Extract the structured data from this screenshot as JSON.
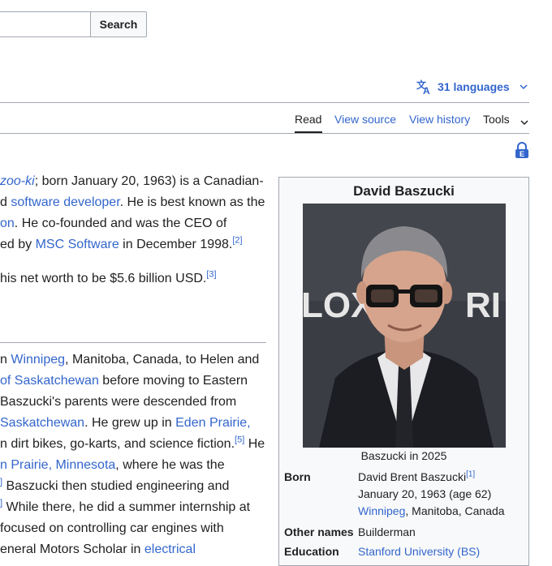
{
  "search": {
    "button_label": "Search",
    "placeholder": ""
  },
  "languages": {
    "label": "31 languages"
  },
  "tabs": {
    "read": "Read",
    "view_source": "View source",
    "view_history": "View history",
    "tools": "Tools"
  },
  "intro": {
    "line1_a": "zoo-ki",
    "line1_b": "; born January 20, 1963) is a Canadian-",
    "line2_a": "d ",
    "line2_link": "software developer",
    "line2_b": ". He is best known as the",
    "line3_link": "on",
    "line3_b": ". He co-founded and was the CEO of",
    "line4_a": "ed by ",
    "line4_link": "MSC Software",
    "line4_b": " in December 1998.",
    "line4_ref": "[2]",
    "line5_a": "his net worth to be $5.6 billion USD.",
    "line5_ref": "[3]"
  },
  "early_life": {
    "l1_a": "n ",
    "l1_link": "Winnipeg",
    "l1_b": ", Manitoba, Canada, to Helen and",
    "l2_link": "of Saskatchewan",
    "l2_b": " before moving to Eastern",
    "l3": "Baszucki's parents were descended from",
    "l4_link": "Saskatchewan",
    "l4_b": ". He grew up in ",
    "l4_link2": "Eden Prairie,",
    "l5_a": "n dirt bikes, go-karts, and science fiction.",
    "l5_ref": "[5]",
    "l5_b": " He",
    "l6_link": "n Prairie, Minnesota",
    "l6_b": ", where he was the",
    "l7_ref": "]",
    "l7_b": " Baszucki then studied engineering and",
    "l8_ref": "]",
    "l8_b": " While there, he did a summer internship at",
    "l9": " focused on controlling car engines with",
    "l10_a": "eneral Motors Scholar in ",
    "l10_link": "electrical"
  },
  "infobox": {
    "title": "David Baszucki",
    "caption": "Baszucki in 2025",
    "born_label": "Born",
    "born_name": "David Brent Baszucki",
    "born_ref": "[1]",
    "born_date": "January 20, 1963 (age 62)",
    "born_place_link": "Winnipeg",
    "born_place_rest": ", Manitoba, Canada",
    "other_names_label": "Other names",
    "other_names_value": "Builderman",
    "education_label": "Education",
    "education_value": "Stanford University (BS)",
    "photo_backdrop_text_left": "LOX",
    "photo_backdrop_text_right": "RI"
  },
  "icons": {
    "languages": "translate-icon",
    "chevron": "chevron-down-icon",
    "lock": "semi-protection-lock-icon"
  },
  "colors": {
    "link": "#3366cc",
    "text": "#202122",
    "border": "#a2a9b1",
    "infobox_bg": "#f8f9fa"
  }
}
